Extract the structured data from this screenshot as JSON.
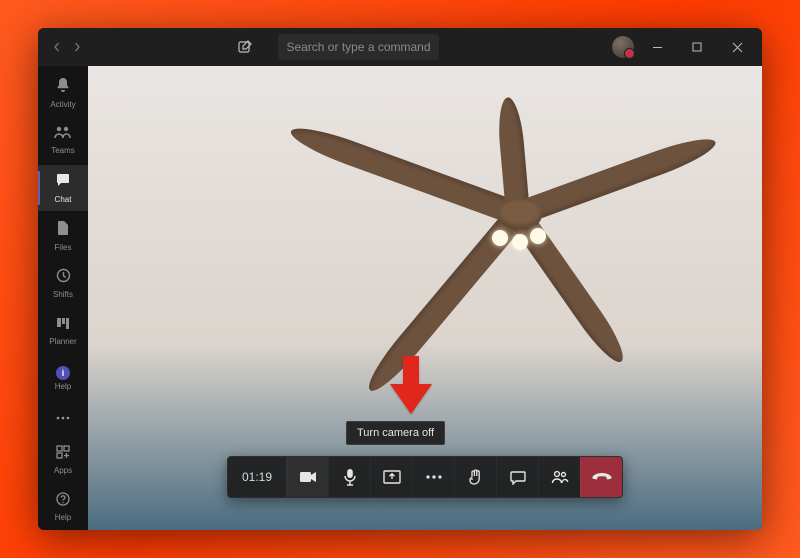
{
  "titlebar": {
    "search_placeholder": "Search or type a command"
  },
  "sidebar": {
    "items": [
      {
        "id": "activity",
        "label": "Activity",
        "icon": "bell-icon"
      },
      {
        "id": "teams",
        "label": "Teams",
        "icon": "teams-people-icon"
      },
      {
        "id": "chat",
        "label": "Chat",
        "icon": "chat-icon",
        "active": true
      },
      {
        "id": "files",
        "label": "Files",
        "icon": "file-icon"
      },
      {
        "id": "shifts",
        "label": "Shifts",
        "icon": "clock-icon"
      },
      {
        "id": "planner",
        "label": "Planner",
        "icon": "planner-icon"
      },
      {
        "id": "help",
        "label": "Help",
        "icon": "help-dot-icon"
      }
    ],
    "apps_label": "Apps",
    "help_label": "Help"
  },
  "call": {
    "timer": "01:19",
    "tooltip": "Turn camera off",
    "buttons": {
      "camera": "camera-icon",
      "mic": "mic-icon",
      "share": "share-screen-icon",
      "more": "more-icon",
      "raise_hand": "raise-hand-icon",
      "chat": "chat-icon",
      "people": "people-icon",
      "hangup": "hangup-icon"
    }
  },
  "annotation": {
    "arrow_color": "#e1261c"
  }
}
